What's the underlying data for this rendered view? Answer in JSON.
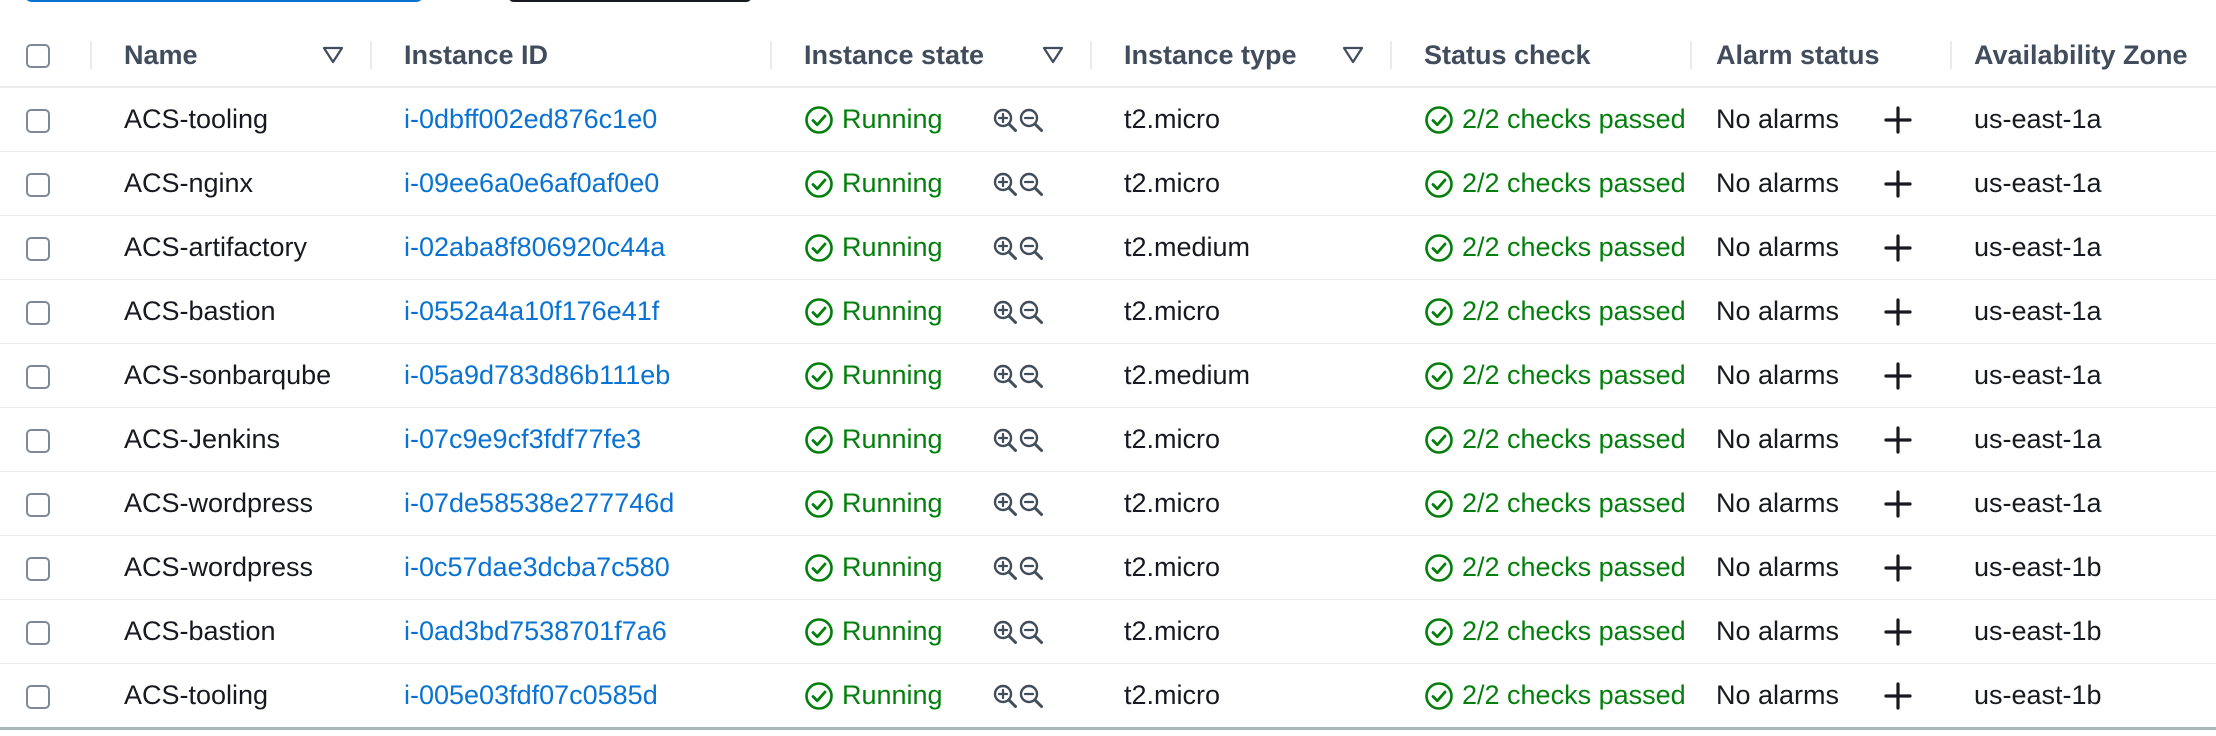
{
  "columns": {
    "name": "Name",
    "instance_id": "Instance ID",
    "instance_state": "Instance state",
    "instance_type": "Instance type",
    "status_check": "Status check",
    "alarm_status": "Alarm status",
    "availability_zone": "Availability Zone"
  },
  "rows": [
    {
      "name": "ACS-tooling",
      "instance_id": "i-0dbff002ed876c1e0",
      "state": "Running",
      "type": "t2.micro",
      "status_check": "2/2 checks passed",
      "alarm": "No alarms",
      "az": "us-east-1a"
    },
    {
      "name": "ACS-nginx",
      "instance_id": "i-09ee6a0e6af0af0e0",
      "state": "Running",
      "type": "t2.micro",
      "status_check": "2/2 checks passed",
      "alarm": "No alarms",
      "az": "us-east-1a"
    },
    {
      "name": "ACS-artifactory",
      "instance_id": "i-02aba8f806920c44a",
      "state": "Running",
      "type": "t2.medium",
      "status_check": "2/2 checks passed",
      "alarm": "No alarms",
      "az": "us-east-1a"
    },
    {
      "name": "ACS-bastion",
      "instance_id": "i-0552a4a10f176e41f",
      "state": "Running",
      "type": "t2.micro",
      "status_check": "2/2 checks passed",
      "alarm": "No alarms",
      "az": "us-east-1a"
    },
    {
      "name": "ACS-sonbarqube",
      "instance_id": "i-05a9d783d86b111eb",
      "state": "Running",
      "type": "t2.medium",
      "status_check": "2/2 checks passed",
      "alarm": "No alarms",
      "az": "us-east-1a"
    },
    {
      "name": "ACS-Jenkins",
      "instance_id": "i-07c9e9cf3fdf77fe3",
      "state": "Running",
      "type": "t2.micro",
      "status_check": "2/2 checks passed",
      "alarm": "No alarms",
      "az": "us-east-1a"
    },
    {
      "name": "ACS-wordpress",
      "instance_id": "i-07de58538e277746d",
      "state": "Running",
      "type": "t2.micro",
      "status_check": "2/2 checks passed",
      "alarm": "No alarms",
      "az": "us-east-1a"
    },
    {
      "name": "ACS-wordpress",
      "instance_id": "i-0c57dae3dcba7c580",
      "state": "Running",
      "type": "t2.micro",
      "status_check": "2/2 checks passed",
      "alarm": "No alarms",
      "az": "us-east-1b"
    },
    {
      "name": "ACS-bastion",
      "instance_id": "i-0ad3bd7538701f7a6",
      "state": "Running",
      "type": "t2.micro",
      "status_check": "2/2 checks passed",
      "alarm": "No alarms",
      "az": "us-east-1b"
    },
    {
      "name": "ACS-tooling",
      "instance_id": "i-005e03fdf07c0585d",
      "state": "Running",
      "type": "t2.micro",
      "status_check": "2/2 checks passed",
      "alarm": "No alarms",
      "az": "us-east-1b"
    }
  ],
  "icons": {
    "state_ok": "check-circle-icon",
    "zoom_in": "zoom-in-icon",
    "zoom_out": "zoom-out-icon",
    "add_alarm": "plus-icon",
    "filter": "filter-triangle-icon"
  },
  "colors": {
    "link": "#0972d3",
    "success": "#037f0c",
    "header_text": "#414d5c",
    "row_divider": "#e9ebed"
  }
}
